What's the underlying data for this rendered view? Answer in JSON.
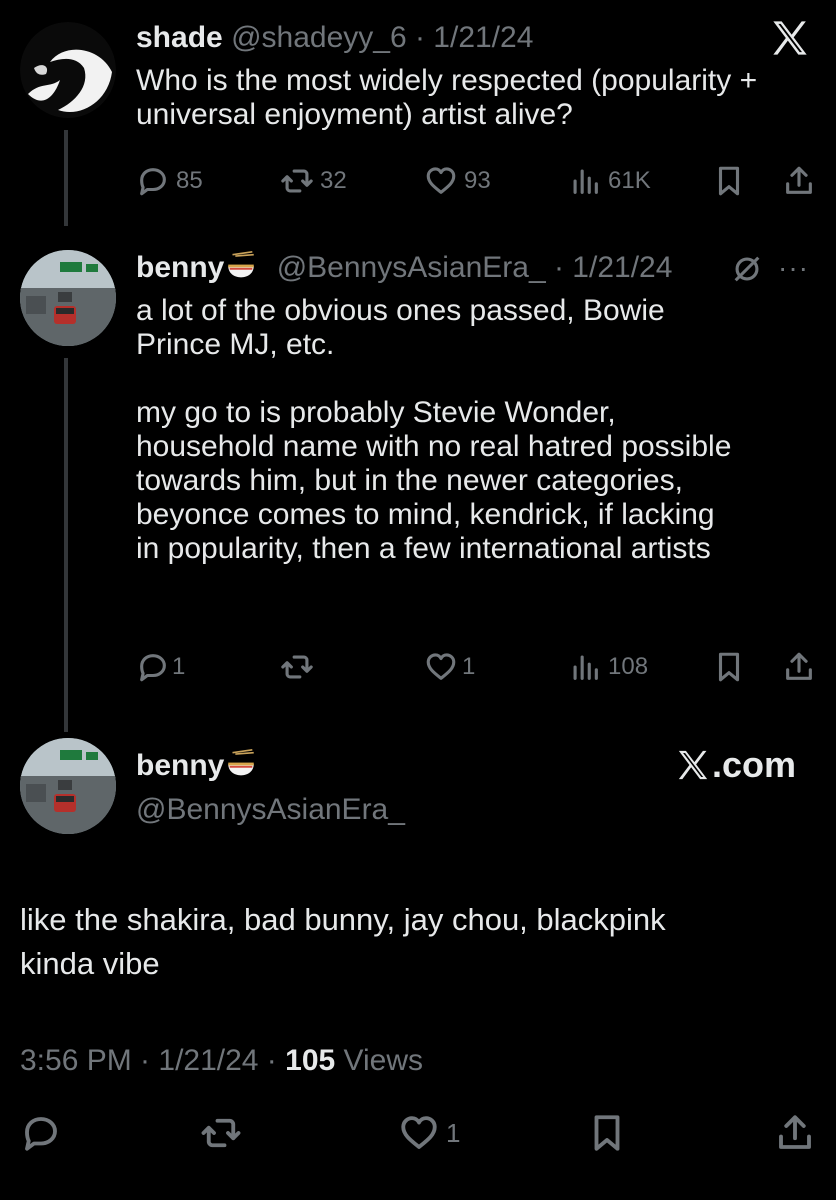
{
  "tweet1": {
    "name": "shade",
    "handle": "@shadeyy_6",
    "date": "· 1/21/24",
    "text": "Who is the most widely respected (popularity + universal enjoyment) artist alive?",
    "replies": "85",
    "retweets": "32",
    "likes": "93",
    "views": "61K"
  },
  "tweet2": {
    "name": "benny",
    "handle": "@BennysAsianEra_",
    "date": "· 1/21/24",
    "text": "a lot of the obvious ones passed, Bowie\nPrince MJ, etc.\n\nmy go to is probably Stevie Wonder,\nhousehold name with no real hatred possible\ntowards him, but in the newer categories,\nbeyonce comes to mind, kendrick, if lacking\nin popularity, then a few international artists",
    "replies": "1",
    "likes": "1",
    "views": "108"
  },
  "main": {
    "name": "benny",
    "handle": "@BennysAsianEra_",
    "watermark": ".com",
    "text": "like the shakira, bad bunny, jay chou, blackpink\nkinda vibe",
    "time": "3:56 PM · 1/21/24 · ",
    "views_count": "105",
    "views_label": " Views",
    "likes": "1"
  },
  "colors": {
    "background": "#000000",
    "text": "#e7e9ea",
    "muted": "#71767b"
  },
  "icons": [
    "x-logo-icon",
    "reply-icon",
    "retweet-icon",
    "like-icon",
    "views-icon",
    "bookmark-icon",
    "share-icon",
    "grok-icon",
    "more-icon",
    "noodle-emoji-icon"
  ]
}
